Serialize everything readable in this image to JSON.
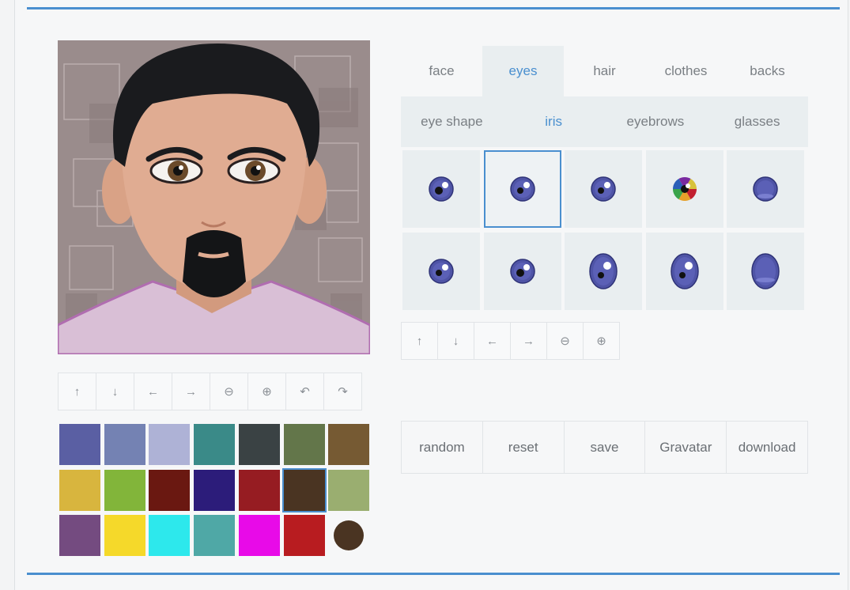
{
  "tabs": [
    "face",
    "eyes",
    "hair",
    "clothes",
    "backs"
  ],
  "active_tab": "eyes",
  "subtabs": [
    "eye shape",
    "iris",
    "eyebrows",
    "glasses"
  ],
  "active_subtab": "iris",
  "avatar_controls": [
    "arrow-up-icon",
    "arrow-down-icon",
    "arrow-left-icon",
    "arrow-right-icon",
    "zoom-out-icon",
    "zoom-in-icon",
    "undo-icon",
    "redo-icon"
  ],
  "avatar_control_glyphs": [
    "↑",
    "↓",
    "←",
    "→",
    "⊖",
    "⊕",
    "↶",
    "↷"
  ],
  "iris_controls": [
    "arrow-up-icon",
    "arrow-down-icon",
    "arrow-left-icon",
    "arrow-right-icon",
    "zoom-out-icon",
    "zoom-in-icon"
  ],
  "iris_control_glyphs": [
    "↑",
    "↓",
    "←",
    "→",
    "⊖",
    "⊕"
  ],
  "colors": [
    "#5a5fa3",
    "#7482b3",
    "#aeb2d6",
    "#3a8a88",
    "#3a4244",
    "#63764a",
    "#765a33",
    "#d8b53e",
    "#82b53a",
    "#6a1811",
    "#2c1c7a",
    "#961c22",
    "#4a3422",
    "#9aae70",
    "#744b80",
    "#f5d92a",
    "#2de8ec",
    "#4fa8a6",
    "#e80ae8",
    "#b81c20"
  ],
  "selected_color": "#4a3422",
  "current_color": "#4a3422",
  "iris_options": [
    {
      "style": "small-dark"
    },
    {
      "style": "highlight"
    },
    {
      "style": "ring"
    },
    {
      "style": "multicolor"
    },
    {
      "style": "plain"
    },
    {
      "style": "highlight-2"
    },
    {
      "style": "small-dark-2"
    },
    {
      "style": "oval-tall"
    },
    {
      "style": "oval-tall-2"
    },
    {
      "style": "oval-plain"
    }
  ],
  "selected_iris_index": 1,
  "actions": [
    "random",
    "reset",
    "save",
    "Gravatar",
    "download"
  ]
}
